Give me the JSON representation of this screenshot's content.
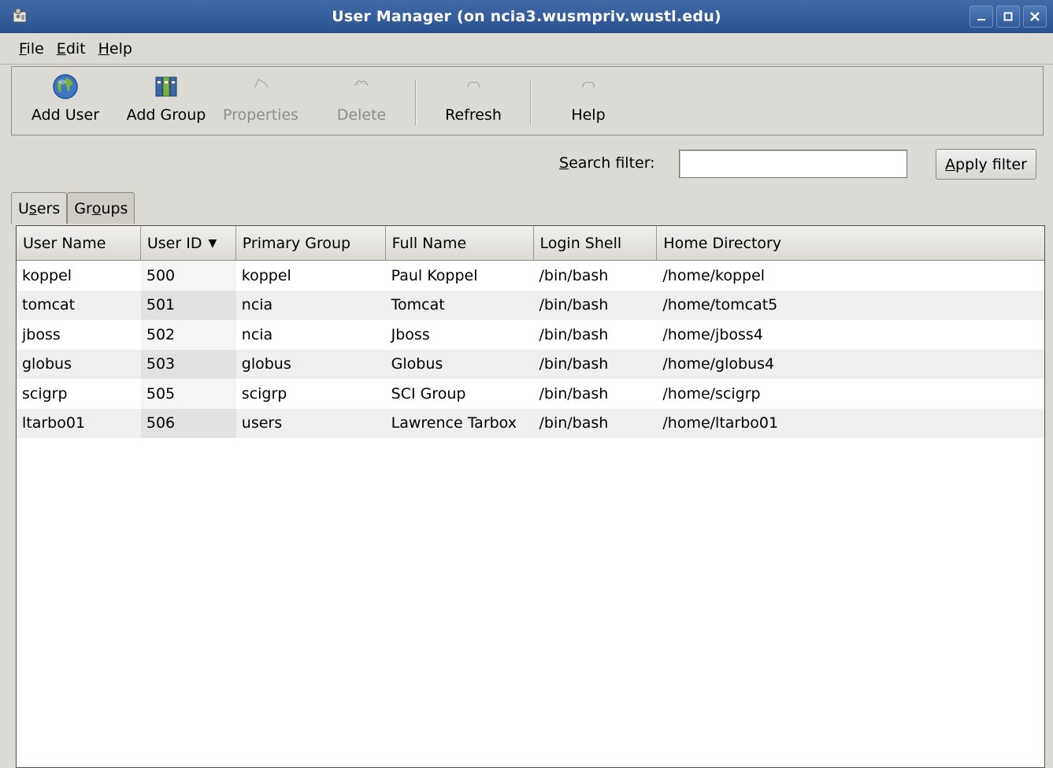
{
  "window": {
    "title": "User Manager (on ncia3.wusmpriv.wustl.edu)"
  },
  "menu": [
    {
      "label": "File",
      "mnemonic": "F",
      "rest": "ile"
    },
    {
      "label": "Edit",
      "mnemonic": "E",
      "rest": "dit"
    },
    {
      "label": "Help",
      "mnemonic": "H",
      "rest": "elp"
    }
  ],
  "toolbar": {
    "add_user": {
      "label": "Add User",
      "icon": "globe-icon",
      "enabled": true
    },
    "add_group": {
      "label": "Add Group",
      "icon": "group-icon",
      "enabled": true
    },
    "properties": {
      "label": "Properties",
      "icon": "properties-icon",
      "enabled": false
    },
    "delete": {
      "label": "Delete",
      "icon": "delete-icon",
      "enabled": false
    },
    "refresh": {
      "label": "Refresh",
      "icon": "refresh-icon",
      "enabled": true
    },
    "help": {
      "label": "Help",
      "icon": "help-icon",
      "enabled": true
    }
  },
  "search": {
    "label_mnemonic": "S",
    "label_rest": "earch filter:",
    "value": "",
    "apply_mnemonic": "A",
    "apply_rest": "pply filter"
  },
  "tabs": [
    {
      "pre": "U",
      "mnemonic": "s",
      "post": "ers",
      "active": true
    },
    {
      "pre": "Gr",
      "mnemonic": "o",
      "post": "ups",
      "active": false
    }
  ],
  "table": {
    "columns": [
      "User Name",
      "User ID",
      "Primary Group",
      "Full Name",
      "Login Shell",
      "Home Directory"
    ],
    "sort_indicator": "▼",
    "rows": [
      [
        "koppel",
        "500",
        "koppel",
        "Paul Koppel",
        "/bin/bash",
        "/home/koppel"
      ],
      [
        "tomcat",
        "501",
        "ncia",
        "Tomcat",
        "/bin/bash",
        "/home/tomcat5"
      ],
      [
        "jboss",
        "502",
        "ncia",
        "Jboss",
        "/bin/bash",
        "/home/jboss4"
      ],
      [
        "globus",
        "503",
        "globus",
        "Globus",
        "/bin/bash",
        "/home/globus4"
      ],
      [
        "scigrp",
        "505",
        "scigrp",
        "SCI Group",
        "/bin/bash",
        "/home/scigrp"
      ],
      [
        "ltarbo01",
        "506",
        "users",
        "Lawrence Tarbox",
        "/bin/bash",
        "/home/ltarbo01"
      ]
    ]
  },
  "colors": {
    "titlebar": "#2a5393",
    "window_bg": "#dcdad5",
    "row_alt": "#efefef",
    "disabled_text": "#8f8d88"
  }
}
